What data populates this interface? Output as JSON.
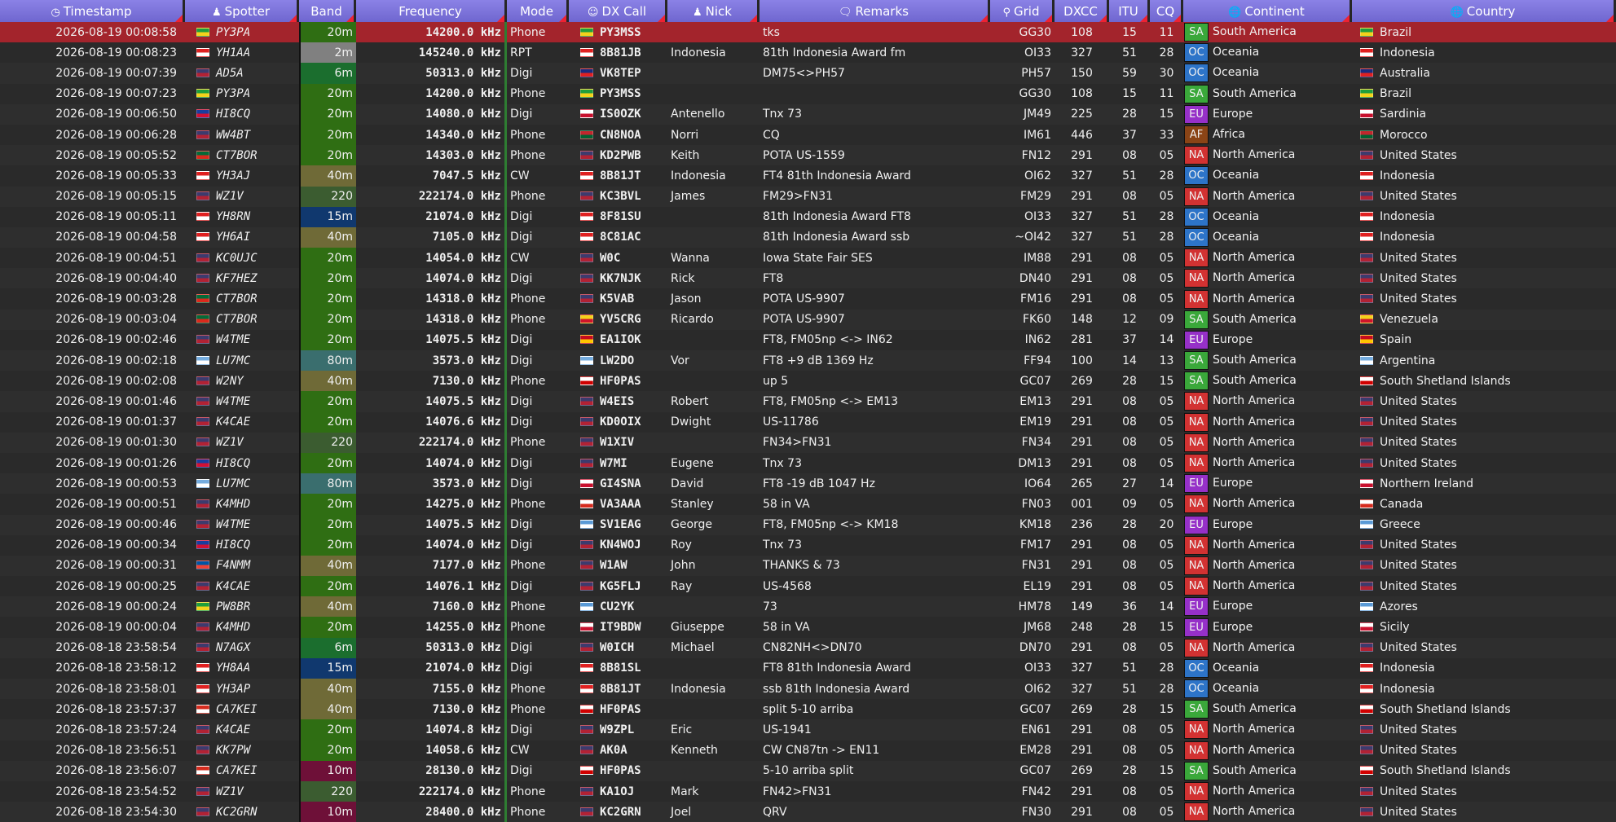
{
  "headers": {
    "timestamp": "Timestamp",
    "spotter": "Spotter",
    "band": "Band",
    "frequency": "Frequency",
    "mode": "Mode",
    "dx_call": "DX Call",
    "nick": "Nick",
    "remarks": "Remarks",
    "grid": "Grid",
    "dxcc": "DXCC",
    "itu": "ITU",
    "cq": "CQ",
    "continent": "Continent",
    "country": "Country"
  },
  "header_icons": {
    "timestamp": "clock-icon",
    "spotter": "user-icon",
    "dx_call": "user-circle-icon",
    "nick": "user-icon",
    "remarks": "comment-icon",
    "grid": "map-pin-icon",
    "continent": "globe-icon",
    "country": "globe-icon"
  },
  "band_colors": {
    "20m": "#2f6e13",
    "2m": "#808080",
    "6m": "#1b6e2e",
    "40m": "#6f6a37",
    "220": "#3b5c30",
    "15m": "#10386e",
    "80m": "#3a6e6e",
    "10m": "#6e1038"
  },
  "continent_colors": {
    "SA": "#3aa83a",
    "OC": "#2d74c8",
    "EU": "#9630c8",
    "AF": "#8a4416",
    "NA": "#d23232"
  },
  "flag_colors": {
    "BR": [
      "#1f9e3c",
      "#f4d21b"
    ],
    "ID": [
      "#e02020",
      "#ffffff"
    ],
    "US": [
      "#3c3b6e",
      "#b22234"
    ],
    "DO": [
      "#1a3d9e",
      "#d21034"
    ],
    "PT": [
      "#046a38",
      "#da291c"
    ],
    "AU": [
      "#1a2a7e",
      "#e02020"
    ],
    "IT": [
      "#ffffff",
      "#c8102e"
    ],
    "MA": [
      "#c1272d",
      "#006233"
    ],
    "AR": [
      "#74acdf",
      "#ffffff"
    ],
    "VE": [
      "#f4d21b",
      "#cf142b"
    ],
    "ES": [
      "#c60b1e",
      "#ffc400"
    ],
    "XS": [
      "#ffffff",
      "#d00000"
    ],
    "GB": [
      "#ffffff",
      "#c8102e"
    ],
    "CA": [
      "#ffffff",
      "#d52b1e"
    ],
    "GR": [
      "#5a9ad6",
      "#ffffff"
    ],
    "FR": [
      "#0055a4",
      "#ef4135"
    ],
    "PT2": [
      "#5a9ad6",
      "#ffffff"
    ],
    "CL": [
      "#d52b1e",
      "#ffffff"
    ]
  },
  "rows": [
    [
      "2026-08-19 00:08:58",
      "BR",
      "PY3PA",
      "20m",
      "14200.0 kHz",
      "Phone",
      "BR",
      "PY3MSS",
      "",
      "tks",
      "GG30",
      "108",
      "15",
      "11",
      "SA",
      "South America",
      "BR",
      "Brazil"
    ],
    [
      "2026-08-19 00:08:23",
      "ID",
      "YH1AA",
      "2m",
      "145240.0 kHz",
      "RPT",
      "ID",
      "8B81JB",
      "Indonesia",
      "81th Indonesia Award fm",
      "OI33",
      "327",
      "51",
      "28",
      "OC",
      "Oceania",
      "ID",
      "Indonesia"
    ],
    [
      "2026-08-19 00:07:39",
      "US",
      "AD5A",
      "6m",
      "50313.0 kHz",
      "Digi",
      "AU",
      "VK8TEP",
      "",
      "DM75<>PH57",
      "PH57",
      "150",
      "59",
      "30",
      "OC",
      "Oceania",
      "AU",
      "Australia"
    ],
    [
      "2026-08-19 00:07:23",
      "BR",
      "PY3PA",
      "20m",
      "14200.0 kHz",
      "Phone",
      "BR",
      "PY3MSS",
      "",
      "",
      "GG30",
      "108",
      "15",
      "11",
      "SA",
      "South America",
      "BR",
      "Brazil"
    ],
    [
      "2026-08-19 00:06:50",
      "DO",
      "HI8CQ",
      "20m",
      "14080.0 kHz",
      "Digi",
      "IT",
      "IS0OZK",
      "Antenello",
      "Tnx 73",
      "JM49",
      "225",
      "28",
      "15",
      "EU",
      "Europe",
      "IT",
      "Sardinia"
    ],
    [
      "2026-08-19 00:06:28",
      "US",
      "WW4BT",
      "20m",
      "14340.0 kHz",
      "Phone",
      "MA",
      "CN8NOA",
      "Norri",
      "CQ",
      "IM61",
      "446",
      "37",
      "33",
      "AF",
      "Africa",
      "MA",
      "Morocco"
    ],
    [
      "2026-08-19 00:05:52",
      "PT",
      "CT7BOR",
      "20m",
      "14303.0 kHz",
      "Phone",
      "US",
      "KD2PWB",
      "Keith",
      "POTA US-1559",
      "FN12",
      "291",
      "08",
      "05",
      "NA",
      "North America",
      "US",
      "United States"
    ],
    [
      "2026-08-19 00:05:33",
      "ID",
      "YH3AJ",
      "40m",
      "7047.5 kHz",
      "CW",
      "ID",
      "8B81JT",
      "Indonesia",
      "FT4 81th Indonesia Award",
      "OI62",
      "327",
      "51",
      "28",
      "OC",
      "Oceania",
      "ID",
      "Indonesia"
    ],
    [
      "2026-08-19 00:05:15",
      "US",
      "WZ1V",
      "220",
      "222174.0 kHz",
      "Phone",
      "US",
      "KC3BVL",
      "James",
      "FM29>FN31",
      "FM29",
      "291",
      "08",
      "05",
      "NA",
      "North America",
      "US",
      "United States"
    ],
    [
      "2026-08-19 00:05:11",
      "ID",
      "YH8RN",
      "15m",
      "21074.0 kHz",
      "Digi",
      "ID",
      "8F81SU",
      "",
      "81th Indonesia Award FT8",
      "OI33",
      "327",
      "51",
      "28",
      "OC",
      "Oceania",
      "ID",
      "Indonesia"
    ],
    [
      "2026-08-19 00:04:58",
      "ID",
      "YH6AI",
      "40m",
      "7105.0 kHz",
      "Digi",
      "ID",
      "8C81AC",
      "",
      "81th Indonesia Award ssb",
      "~OI42",
      "327",
      "51",
      "28",
      "OC",
      "Oceania",
      "ID",
      "Indonesia"
    ],
    [
      "2026-08-19 00:04:51",
      "US",
      "KC0UJC",
      "20m",
      "14054.0 kHz",
      "CW",
      "US",
      "W0C",
      "Wanna",
      "Iowa State Fair SES",
      "IM88",
      "291",
      "08",
      "05",
      "NA",
      "North America",
      "US",
      "United States"
    ],
    [
      "2026-08-19 00:04:40",
      "US",
      "KF7HEZ",
      "20m",
      "14074.0 kHz",
      "Digi",
      "US",
      "KK7NJK",
      "Rick",
      "FT8",
      "DN40",
      "291",
      "08",
      "05",
      "NA",
      "North America",
      "US",
      "United States"
    ],
    [
      "2026-08-19 00:03:28",
      "PT",
      "CT7BOR",
      "20m",
      "14318.0 kHz",
      "Phone",
      "US",
      "K5VAB",
      "Jason",
      "POTA US-9907",
      "FM16",
      "291",
      "08",
      "05",
      "NA",
      "North America",
      "US",
      "United States"
    ],
    [
      "2026-08-19 00:03:04",
      "PT",
      "CT7BOR",
      "20m",
      "14318.0 kHz",
      "Phone",
      "VE",
      "YV5CRG",
      "Ricardo",
      "POTA US-9907",
      "FK60",
      "148",
      "12",
      "09",
      "SA",
      "South America",
      "VE",
      "Venezuela"
    ],
    [
      "2026-08-19 00:02:46",
      "US",
      "W4TME",
      "20m",
      "14075.5 kHz",
      "Digi",
      "ES",
      "EA1IOK",
      "",
      "FT8, FM05np <-> IN62",
      "IN62",
      "281",
      "37",
      "14",
      "EU",
      "Europe",
      "ES",
      "Spain"
    ],
    [
      "2026-08-19 00:02:18",
      "AR",
      "LU7MC",
      "80m",
      "3573.0 kHz",
      "Digi",
      "AR",
      "LW2DO",
      "Vor",
      "FT8 +9 dB 1369 Hz",
      "FF94",
      "100",
      "14",
      "13",
      "SA",
      "South America",
      "AR",
      "Argentina"
    ],
    [
      "2026-08-19 00:02:08",
      "US",
      "W2NY",
      "40m",
      "7130.0 kHz",
      "Phone",
      "XS",
      "HF0PAS",
      "",
      "up 5",
      "GC07",
      "269",
      "28",
      "15",
      "SA",
      "South America",
      "XS",
      "South Shetland Islands"
    ],
    [
      "2026-08-19 00:01:46",
      "US",
      "W4TME",
      "20m",
      "14075.5 kHz",
      "Digi",
      "US",
      "W4EIS",
      "Robert",
      "FT8, FM05np <-> EM13",
      "EM13",
      "291",
      "08",
      "05",
      "NA",
      "North America",
      "US",
      "United States"
    ],
    [
      "2026-08-19 00:01:37",
      "US",
      "K4CAE",
      "20m",
      "14076.6 kHz",
      "Digi",
      "US",
      "KD0OIX",
      "Dwight",
      "US-11786",
      "EM19",
      "291",
      "08",
      "05",
      "NA",
      "North America",
      "US",
      "United States"
    ],
    [
      "2026-08-19 00:01:30",
      "US",
      "WZ1V",
      "220",
      "222174.0 kHz",
      "Phone",
      "US",
      "W1XIV",
      "",
      "FN34>FN31",
      "FN34",
      "291",
      "08",
      "05",
      "NA",
      "North America",
      "US",
      "United States"
    ],
    [
      "2026-08-19 00:01:26",
      "DO",
      "HI8CQ",
      "20m",
      "14074.0 kHz",
      "Digi",
      "US",
      "W7MI",
      "Eugene",
      "Tnx 73",
      "DM13",
      "291",
      "08",
      "05",
      "NA",
      "North America",
      "US",
      "United States"
    ],
    [
      "2026-08-19 00:00:53",
      "AR",
      "LU7MC",
      "80m",
      "3573.0 kHz",
      "Digi",
      "GB",
      "GI4SNA",
      "David",
      "FT8 -19 dB 1047 Hz",
      "IO64",
      "265",
      "27",
      "14",
      "EU",
      "Europe",
      "GB",
      "Northern Ireland"
    ],
    [
      "2026-08-19 00:00:51",
      "US",
      "K4MHD",
      "20m",
      "14275.0 kHz",
      "Phone",
      "CA",
      "VA3AAA",
      "Stanley",
      "58 in VA",
      "FN03",
      "001",
      "09",
      "05",
      "NA",
      "North America",
      "CA",
      "Canada"
    ],
    [
      "2026-08-19 00:00:46",
      "US",
      "W4TME",
      "20m",
      "14075.5 kHz",
      "Digi",
      "GR",
      "SV1EAG",
      "George",
      "FT8, FM05np <-> KM18",
      "KM18",
      "236",
      "28",
      "20",
      "EU",
      "Europe",
      "GR",
      "Greece"
    ],
    [
      "2026-08-19 00:00:34",
      "DO",
      "HI8CQ",
      "20m",
      "14074.0 kHz",
      "Digi",
      "US",
      "KN4WOJ",
      "Roy",
      "Tnx 73",
      "FM17",
      "291",
      "08",
      "05",
      "NA",
      "North America",
      "US",
      "United States"
    ],
    [
      "2026-08-19 00:00:31",
      "FR",
      "F4NMM",
      "40m",
      "7177.0 kHz",
      "Phone",
      "US",
      "W1AW",
      "John",
      "THANKS & 73",
      "FN31",
      "291",
      "08",
      "05",
      "NA",
      "North America",
      "US",
      "United States"
    ],
    [
      "2026-08-19 00:00:25",
      "US",
      "K4CAE",
      "20m",
      "14076.1 kHz",
      "Digi",
      "US",
      "KG5FLJ",
      "Ray",
      "US-4568",
      "EL19",
      "291",
      "08",
      "05",
      "NA",
      "North America",
      "US",
      "United States"
    ],
    [
      "2026-08-19 00:00:24",
      "BR",
      "PW8BR",
      "40m",
      "7160.0 kHz",
      "Phone",
      "PT2",
      "CU2YK",
      "",
      "73",
      "HM78",
      "149",
      "36",
      "14",
      "EU",
      "Europe",
      "PT2",
      "Azores"
    ],
    [
      "2026-08-19 00:00:04",
      "US",
      "K4MHD",
      "20m",
      "14255.0 kHz",
      "Phone",
      "IT",
      "IT9BDW",
      "Giuseppe",
      "58 in VA",
      "JM68",
      "248",
      "28",
      "15",
      "EU",
      "Europe",
      "IT",
      "Sicily"
    ],
    [
      "2026-08-18 23:58:54",
      "US",
      "N7AGX",
      "6m",
      "50313.0 kHz",
      "Digi",
      "US",
      "W0ICH",
      "Michael",
      "CN82NH<>DN70",
      "DN70",
      "291",
      "08",
      "05",
      "NA",
      "North America",
      "US",
      "United States"
    ],
    [
      "2026-08-18 23:58:12",
      "ID",
      "YH8AA",
      "15m",
      "21074.0 kHz",
      "Digi",
      "ID",
      "8B81SL",
      "",
      "FT8 81th Indonesia Award",
      "OI33",
      "327",
      "51",
      "28",
      "OC",
      "Oceania",
      "ID",
      "Indonesia"
    ],
    [
      "2026-08-18 23:58:01",
      "ID",
      "YH3AP",
      "40m",
      "7155.0 kHz",
      "Phone",
      "ID",
      "8B81JT",
      "Indonesia",
      "ssb 81th Indonesia Award",
      "OI62",
      "327",
      "51",
      "28",
      "OC",
      "Oceania",
      "ID",
      "Indonesia"
    ],
    [
      "2026-08-18 23:57:37",
      "CL",
      "CA7KEI",
      "40m",
      "7130.0 kHz",
      "Phone",
      "XS",
      "HF0PAS",
      "",
      "split 5-10 arriba",
      "GC07",
      "269",
      "28",
      "15",
      "SA",
      "South America",
      "XS",
      "South Shetland Islands"
    ],
    [
      "2026-08-18 23:57:24",
      "US",
      "K4CAE",
      "20m",
      "14074.8 kHz",
      "Digi",
      "US",
      "W9ZPL",
      "Eric",
      "US-1941",
      "EN61",
      "291",
      "08",
      "05",
      "NA",
      "North America",
      "US",
      "United States"
    ],
    [
      "2026-08-18 23:56:51",
      "US",
      "KK7PW",
      "20m",
      "14058.6 kHz",
      "CW",
      "US",
      "AK0A",
      "Kenneth",
      "CW CN87tn -> EN11",
      "EM28",
      "291",
      "08",
      "05",
      "NA",
      "North America",
      "US",
      "United States"
    ],
    [
      "2026-08-18 23:56:07",
      "CL",
      "CA7KEI",
      "10m",
      "28130.0 kHz",
      "Digi",
      "XS",
      "HF0PAS",
      "",
      "5-10 arriba split",
      "GC07",
      "269",
      "28",
      "15",
      "SA",
      "South America",
      "XS",
      "South Shetland Islands"
    ],
    [
      "2026-08-18 23:54:52",
      "US",
      "WZ1V",
      "220",
      "222174.0 kHz",
      "Phone",
      "US",
      "KA1OJ",
      "Mark",
      "FN42>FN31",
      "FN42",
      "291",
      "08",
      "05",
      "NA",
      "North America",
      "US",
      "United States"
    ],
    [
      "2026-08-18 23:54:30",
      "US",
      "KC2GRN",
      "10m",
      "28400.0 kHz",
      "Phone",
      "US",
      "KC2GRN",
      "Joel",
      "QRV",
      "FN30",
      "291",
      "08",
      "05",
      "NA",
      "North America",
      "US",
      "United States"
    ]
  ]
}
